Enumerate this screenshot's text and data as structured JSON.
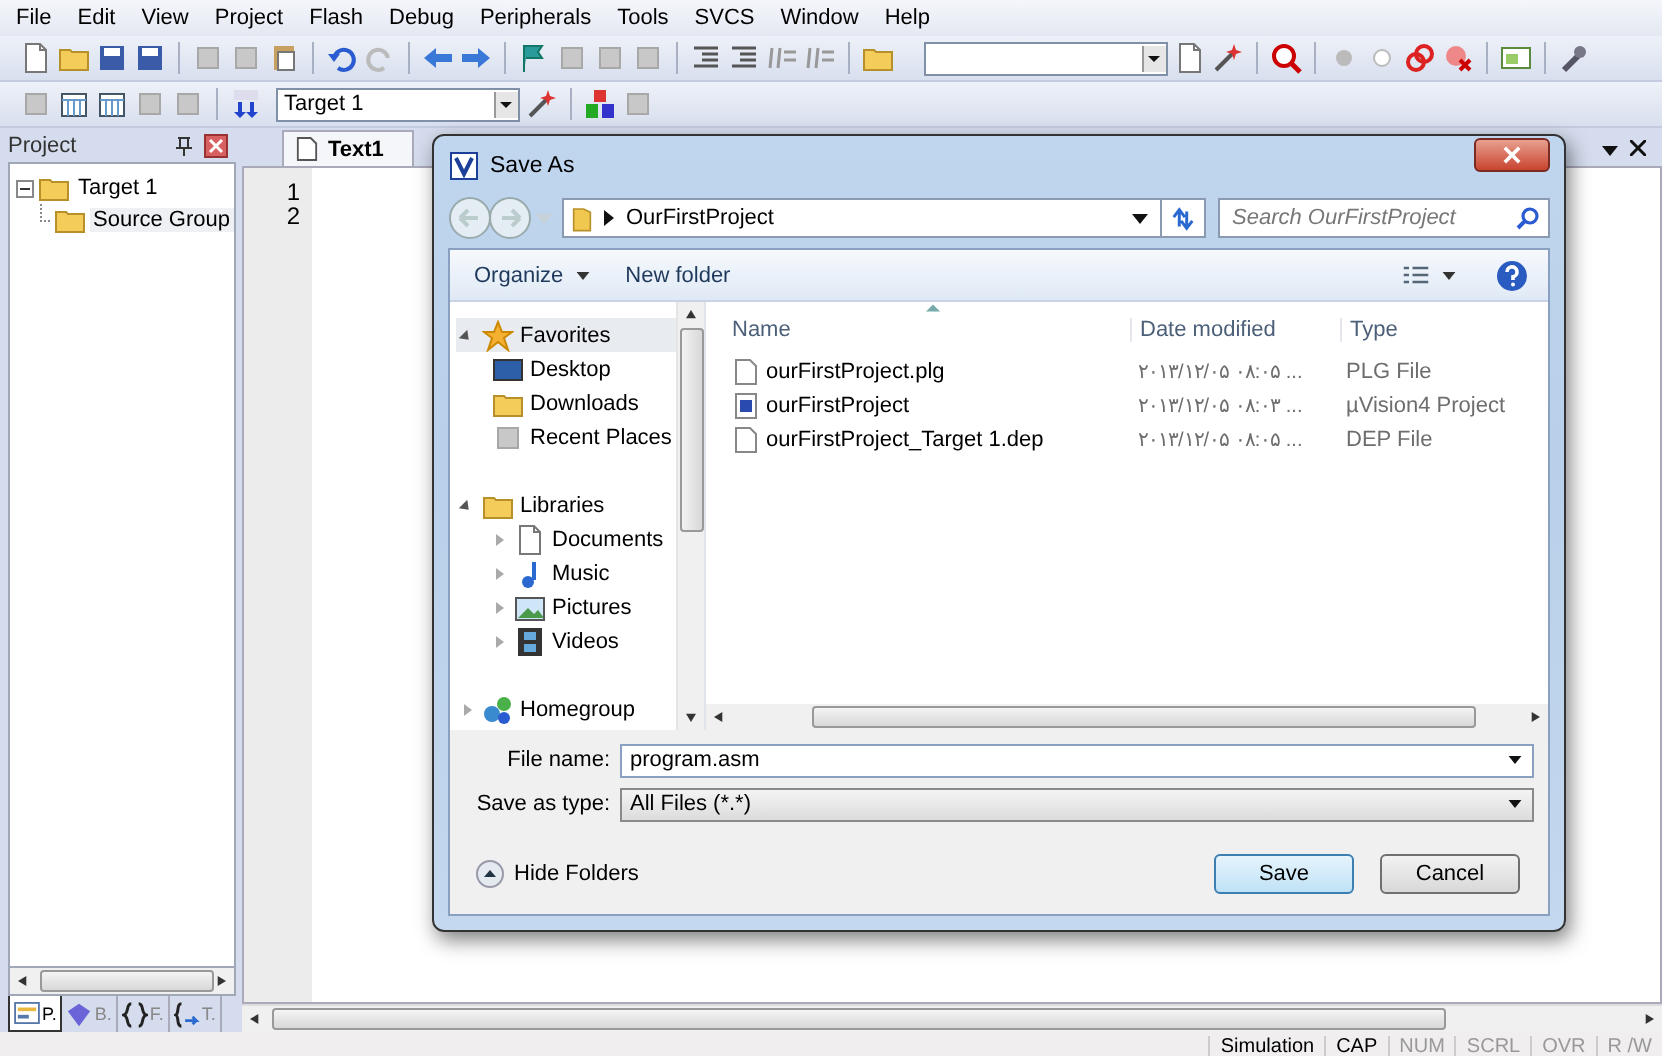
{
  "menu_bar": [
    "File",
    "Edit",
    "View",
    "Project",
    "Flash",
    "Debug",
    "Peripherals",
    "Tools",
    "SVCS",
    "Window",
    "Help"
  ],
  "toolbar": {
    "target_select": "Target 1"
  },
  "project_panel": {
    "title": "Project",
    "tree": [
      {
        "label": "Target 1",
        "expanded": true,
        "children": [
          {
            "label": "Source Group",
            "selected": true
          }
        ]
      }
    ],
    "tabs": [
      {
        "label": "P.",
        "selected": true
      },
      {
        "label": "B.",
        "selected": false
      },
      {
        "label": "F.",
        "selected": false
      },
      {
        "label": "T.",
        "selected": false
      }
    ]
  },
  "editor": {
    "tabs": [
      {
        "label": "Text1",
        "selected": true
      }
    ],
    "line_numbers": [
      "1",
      "2"
    ]
  },
  "dialog": {
    "title": "Save As",
    "address": "OurFirstProject",
    "search_placeholder": "Search OurFirstProject",
    "commands": [
      {
        "label": "Organize",
        "has_menu": true
      },
      {
        "label": "New folder",
        "has_menu": false
      }
    ],
    "nav": [
      {
        "label": "Favorites",
        "expanded": true,
        "selected": true,
        "children": [
          {
            "label": "Desktop",
            "selected": false
          },
          {
            "label": "Downloads",
            "selected": false
          },
          {
            "label": "Recent Places",
            "selected": false
          }
        ]
      },
      {
        "label": "Libraries",
        "expanded": true,
        "selected": false,
        "children": [
          {
            "label": "Documents",
            "selected": false
          },
          {
            "label": "Music",
            "selected": false
          },
          {
            "label": "Pictures",
            "selected": false
          },
          {
            "label": "Videos",
            "selected": false
          }
        ]
      },
      {
        "label": "Homegroup",
        "expanded": false,
        "selected": false
      }
    ],
    "columns": [
      "Name",
      "Date modified",
      "Type"
    ],
    "files": [
      {
        "name": "ourFirstProject.plg",
        "date": "۲۰۱۳/۱۲/۰۵ ۰۸:۰۵ ...",
        "type": "PLG File",
        "kind": "document"
      },
      {
        "name": "ourFirstProject",
        "date": "۲۰۱۳/۱۲/۰۵ ۰۸:۰۳ ...",
        "type": "µVision4 Project",
        "kind": "project"
      },
      {
        "name": "ourFirstProject_Target 1.dep",
        "date": "۲۰۱۳/۱۲/۰۵ ۰۸:۰۵ ...",
        "type": "DEP File",
        "kind": "document"
      }
    ],
    "file_name_label": "File name:",
    "file_name": "program.asm",
    "type_label": "Save as type:",
    "save_type": "All Files (*.*)",
    "hide_folders": "Hide Folders",
    "buttons": [
      {
        "label": "Save",
        "default": true
      },
      {
        "label": "Cancel",
        "default": false
      }
    ]
  },
  "status_bar": [
    {
      "text": "Simulation",
      "on": true
    },
    {
      "text": "CAP",
      "on": true
    },
    {
      "text": "NUM",
      "on": false
    },
    {
      "text": "SCRL",
      "on": false
    },
    {
      "text": "OVR",
      "on": false
    },
    {
      "text": "R /W",
      "on": false
    }
  ]
}
